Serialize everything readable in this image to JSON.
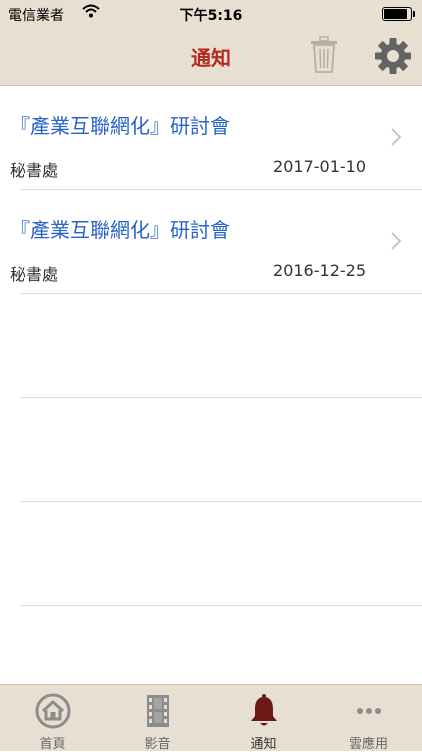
{
  "status_bar": {
    "carrier": "電信業者",
    "time": "下午5:16",
    "battery_level": 0.95
  },
  "nav": {
    "title": "通知",
    "trash_icon": "trash-icon",
    "settings_icon": "gear-icon"
  },
  "notifications": [
    {
      "title": "『產業互聯網化』研討會",
      "sender": "秘書處",
      "date": "2017-01-10"
    },
    {
      "title": "『產業互聯網化』研討會",
      "sender": "秘書處",
      "date": "2016-12-25"
    }
  ],
  "tabs": [
    {
      "label": "首頁",
      "icon": "home-icon"
    },
    {
      "label": "影音",
      "icon": "film-icon"
    },
    {
      "label": "通知",
      "icon": "bell-icon",
      "active": true
    },
    {
      "label": "雲應用",
      "icon": "more-icon"
    }
  ],
  "colors": {
    "bar_bg": "#e7dfd2",
    "title_red": "#b32a1f",
    "link_blue": "#2a63c6",
    "active_icon": "#6b1a14",
    "inactive_icon": "#8c8c8c"
  }
}
